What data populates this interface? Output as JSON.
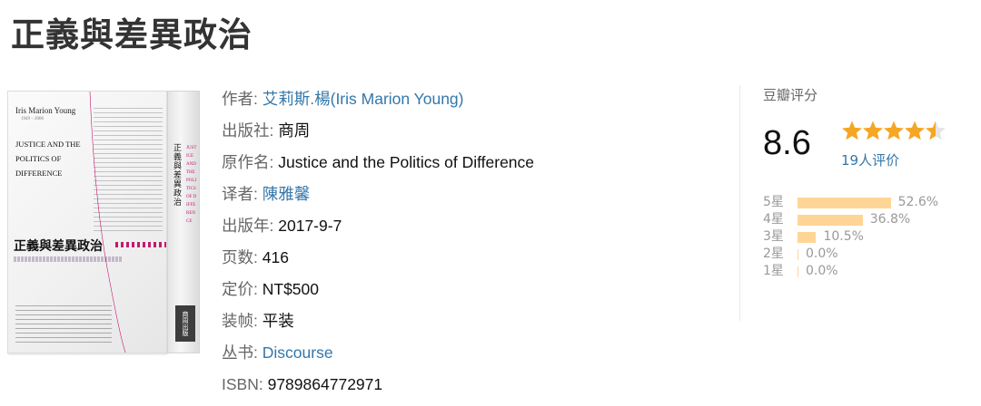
{
  "page": {
    "title": "正義與差異政治"
  },
  "book_cover": {
    "author": "Iris Marion Young",
    "years": "1949 – 2006",
    "title_en": "JUSTICE AND THE POLITICS OF DIFFERENCE",
    "title_zh": "正義與差異政治",
    "spine_title": "正義與差異政治",
    "spine_en": "JUSTICE AND THE POLITICS OF DIFFERENCE",
    "publisher_logo": "商周出版"
  },
  "info": {
    "author_label": "作者:",
    "author": "艾莉斯.楊(Iris Marion Young)",
    "publisher_label": "出版社:",
    "publisher": "商周",
    "original_title_label": "原作名:",
    "original_title": "Justice and the Politics of Difference",
    "translator_label": "译者:",
    "translator": "陳雅馨",
    "pub_year_label": "出版年:",
    "pub_year": "2017-9-7",
    "pages_label": "页数:",
    "pages": "416",
    "price_label": "定价:",
    "price": "NT$500",
    "binding_label": "装帧:",
    "binding": "平装",
    "series_label": "丛书:",
    "series": "Discourse",
    "isbn_label": "ISBN:",
    "isbn": "9789864772971"
  },
  "rating": {
    "title": "豆瓣评分",
    "score": "8.6",
    "stars": 4.5,
    "count_text": "19人评价",
    "star_color": "#f5a623",
    "bar_color": "#ffd596",
    "link_color": "#3377aa",
    "distribution": [
      {
        "label": "5星",
        "percent": 52.6,
        "text": "52.6%"
      },
      {
        "label": "4星",
        "percent": 36.8,
        "text": "36.8%"
      },
      {
        "label": "3星",
        "percent": 10.5,
        "text": "10.5%"
      },
      {
        "label": "2星",
        "percent": 0.0,
        "text": "0.0%"
      },
      {
        "label": "1星",
        "percent": 0.0,
        "text": "0.0%"
      }
    ]
  }
}
